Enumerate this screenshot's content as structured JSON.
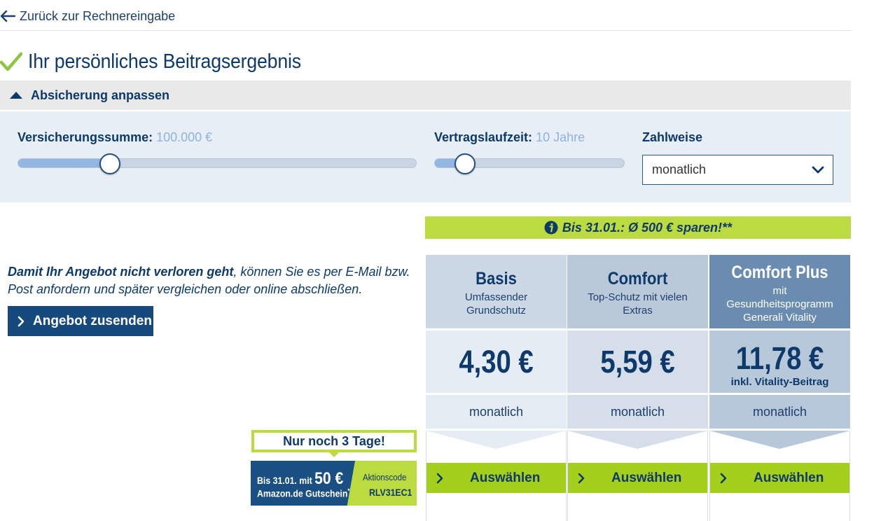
{
  "nav": {
    "back_label": "Zurück zur Rechnereingabe"
  },
  "page": {
    "title": "Ihr persönliches Beitragsergebnis"
  },
  "accordion": {
    "title": "Absicherung anpassen"
  },
  "controls": {
    "sum_label": "Versicherungssumme:",
    "sum_value": "100.000 €",
    "sum_fill_fraction": 0.23,
    "term_label": "Vertragslaufzeit:",
    "term_value": "10 Jahre",
    "term_fill_fraction": 0.16,
    "payment_label": "Zahlweise",
    "payment_value": "monatlich"
  },
  "promo": {
    "banner_text": "Bis 31.01.: Ø 500 € sparen!**"
  },
  "offer": {
    "text_bold": "Damit Ihr Angebot nicht verloren geht",
    "text_rest": ", können Sie es per E-Mail bzw. Post anfordern und später vergleichen oder online abschließen.",
    "send_button": "Angebot zusenden"
  },
  "coupon": {
    "days_left": "Nur noch 3 Tage!",
    "line1_prefix": "Bis 31.01. mit",
    "amount": "50 €",
    "line2": "Amazon.de Gutschein",
    "line2_mark": "*",
    "code_label": "Aktionscode",
    "code": "RLV31EC1"
  },
  "plans": [
    {
      "name": "Basis",
      "subtitle": "Umfassender Grundschutz",
      "price": "4,30 €",
      "note": "",
      "period": "monatlich",
      "button": "Auswählen"
    },
    {
      "name": "Comfort",
      "subtitle": "Top-Schutz mit vielen Extras",
      "price": "5,59 €",
      "note": "",
      "period": "monatlich",
      "button": "Auswählen"
    },
    {
      "name": "Comfort Plus",
      "subtitle": "mit Gesundheitsprogramm Generali Vitality",
      "price": "11,78 €",
      "note": "inkl. Vitality-Beitrag",
      "period": "monatlich",
      "button": "Auswählen"
    }
  ],
  "colors": {
    "brand_blue": "#0d3a6a",
    "accent_green": "#bcdb40",
    "button_green": "#a5cf1d"
  }
}
